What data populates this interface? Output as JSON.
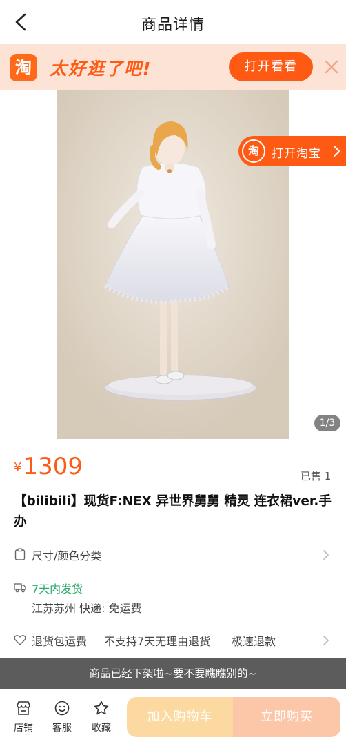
{
  "nav": {
    "title": "商品详情",
    "back_icon": "chevron-left-icon"
  },
  "banner": {
    "logo_text": "淘",
    "slogan": "太好逛了吧!",
    "open_label": "打开看看",
    "close_icon": "close-icon",
    "accent": "#ff5a14",
    "bg": "#fde3d6"
  },
  "gallery": {
    "open_taobao_badge": "淘",
    "open_taobao_label": "打开淘宝",
    "counter": "1/3"
  },
  "product": {
    "currency": "¥",
    "price": "1309",
    "sold": "已售 1",
    "title": "【bilibili】现货F:NEX 异世界舅舅 精灵 连衣裙ver.手办"
  },
  "sku": {
    "label": "尺寸/颜色分类",
    "icon": "clipboard-icon"
  },
  "shipping": {
    "icon": "truck-icon",
    "dispatch": "7天内发货",
    "origin": "江苏苏州 快递: 免运费",
    "dispatch_color": "#2bab6a"
  },
  "guarantee": {
    "icon": "heart-icon",
    "items": [
      "退货包运费",
      "不支持7天无理由退货",
      "极速退款"
    ]
  },
  "notice": "商品已经下架啦~要不要瞧瞧别的~",
  "toolbar": {
    "shop_label": "店铺",
    "service_label": "客服",
    "fav_label": "收藏",
    "cart_label": "加入购物车",
    "buy_label": "立即购买"
  }
}
